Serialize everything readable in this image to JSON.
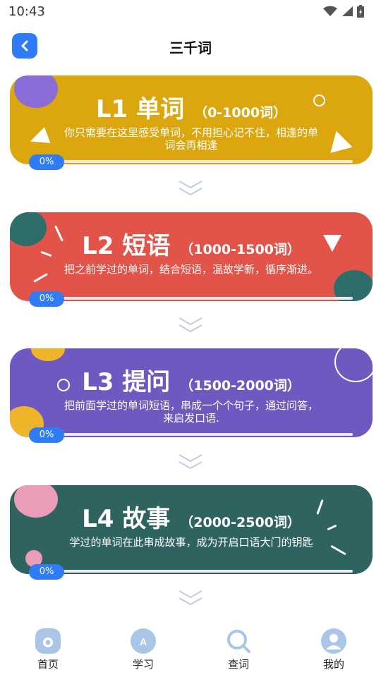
{
  "status_bar": {
    "time": "10:43"
  },
  "header": {
    "title": "三千词"
  },
  "levels": [
    {
      "title": "L1 单词",
      "range": "（0-1000词）",
      "description": "你只需要在这里感受单词，不用担心记不住，相逢的单词会再相逢",
      "progress": "0%",
      "color": "#dba60e"
    },
    {
      "title": "L2 短语",
      "range": "（1000-1500词）",
      "description": "把之前学过的单词，结合短语，温故学新，循序渐进。",
      "progress": "0%",
      "color": "#e2544a"
    },
    {
      "title": "L3 提问",
      "range": "（1500-2000词）",
      "description": "把前面学过的单词短语，串成一个个句子，通过问答，来启发口语.",
      "progress": "0%",
      "color": "#6f59c0"
    },
    {
      "title": "L4 故事",
      "range": "（2000-2500词）",
      "description": "学过的单词在此串成故事，成为开启口语大门的钥匙",
      "progress": "0%",
      "color": "#2e6360"
    }
  ],
  "tabbar": {
    "items": [
      {
        "label": "首页",
        "icon": "home-icon"
      },
      {
        "label": "学习",
        "icon": "study-icon"
      },
      {
        "label": "查词",
        "icon": "search-icon"
      },
      {
        "label": "我的",
        "icon": "profile-icon"
      }
    ]
  },
  "colors": {
    "accent": "#2f7cf6",
    "tab_icon": "#a9c6e6"
  }
}
